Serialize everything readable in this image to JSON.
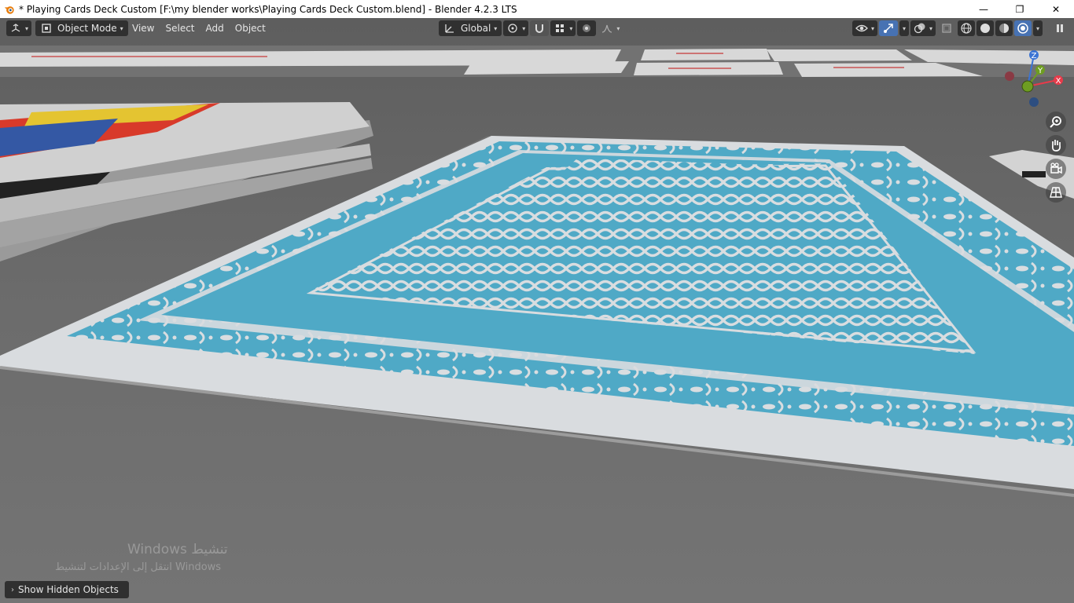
{
  "window": {
    "title": "* Playing Cards Deck Custom [F:\\my blender works\\Playing Cards Deck Custom.blend] - Blender 4.2.3 LTS",
    "minimize_glyph": "—",
    "maximize_glyph": "❐",
    "close_glyph": "✕"
  },
  "header": {
    "editor_type_icon": "3d-viewport-icon",
    "mode_label": "Object Mode",
    "menus": [
      "View",
      "Select",
      "Add",
      "Object"
    ],
    "transform_orientation": "Global",
    "pivot_icon": "pivot-icon",
    "snap_icon": "snap-magnet-icon",
    "proportional_icon": "proportional-edit-icon",
    "visibility_icon": "eye-icon",
    "gizmo_icon": "gizmo-icon",
    "overlay_icon": "overlay-icon",
    "xray_icon": "xray-icon",
    "shading_icons": [
      "wireframe-shading-icon",
      "solid-shading-icon",
      "material-shading-icon",
      "rendered-shading-icon"
    ]
  },
  "gizmo": {
    "axes": [
      "Z",
      "Y",
      "X"
    ],
    "colors": {
      "x": "#e83a4a",
      "y": "#6e9d21",
      "z": "#3b74d4"
    }
  },
  "nav": [
    "zoom-icon",
    "hand-pan-icon",
    "camera-icon",
    "grid-perspective-icon"
  ],
  "watermark": {
    "line1": "Windows تنشيط",
    "line2": "انتقل إلى الإعدادات لتنشيط Windows"
  },
  "panel": {
    "show_hidden_label": "Show Hidden Objects"
  },
  "colors": {
    "accent": "#4772b3",
    "card_blue": "#4fa9c6",
    "card_white": "#cfcfcf",
    "table": "#6a6a6a"
  }
}
